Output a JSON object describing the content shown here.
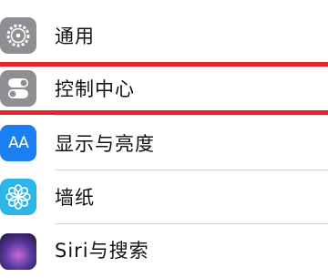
{
  "settings": {
    "items": [
      {
        "label": "通用",
        "icon": "gear-icon",
        "icon_color": "#8e8e93"
      },
      {
        "label": "控制中心",
        "icon": "toggle-icon",
        "icon_color": "#8e8e93"
      },
      {
        "label": "显示与亮度",
        "icon": "text-size-icon",
        "icon_color": "#1a7ff0",
        "icon_text": "AA"
      },
      {
        "label": "墙纸",
        "icon": "flower-icon",
        "icon_color": "#2fb6e8"
      },
      {
        "label": "Siri与搜索",
        "icon": "siri-icon",
        "icon_color": "#3a2a66"
      }
    ],
    "highlighted_index": 1,
    "highlight_color": "#e3242b"
  }
}
